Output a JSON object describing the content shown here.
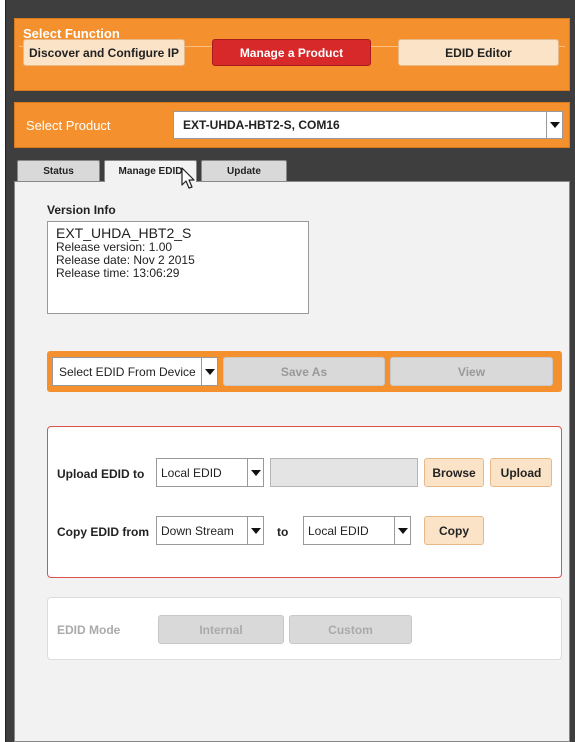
{
  "select_function": {
    "title": "Select Function",
    "buttons": [
      {
        "label": "Discover and Configure IP",
        "state": "inactive"
      },
      {
        "label": "Manage a Product",
        "state": "active"
      },
      {
        "label": "EDID Editor",
        "state": "inactive"
      }
    ]
  },
  "select_product": {
    "label": "Select Product",
    "selected": "EXT-UHDA-HBT2-S, COM16"
  },
  "tabs": [
    {
      "label": "Status",
      "active": false
    },
    {
      "label": "Manage EDID",
      "active": true
    },
    {
      "label": "Update",
      "active": false
    }
  ],
  "version_info": {
    "title": "Version Info",
    "lines": [
      "EXT_UHDA_HBT2_S",
      "Release version: 1.00",
      "Release date: Nov  2 2015",
      "Release time: 13:06:29"
    ]
  },
  "edid_actions": {
    "source_select": "Select EDID From Device",
    "save_as_label": "Save As",
    "view_label": "View"
  },
  "upload": {
    "label": "Upload EDID to",
    "target": "Local EDID",
    "path_value": "",
    "browse_label": "Browse",
    "upload_label": "Upload"
  },
  "copy": {
    "label": "Copy EDID from",
    "source": "Down Stream",
    "to_label": "to",
    "destination": "Local EDID",
    "copy_label": "Copy"
  },
  "edid_mode": {
    "label": "EDID Mode",
    "internal_label": "Internal",
    "custom_label": "Custom"
  },
  "colors": {
    "accent_orange": "#f4912e",
    "active_red": "#d7282a",
    "peach": "#fbe3c8",
    "frame_dark": "#3e3e3e"
  }
}
